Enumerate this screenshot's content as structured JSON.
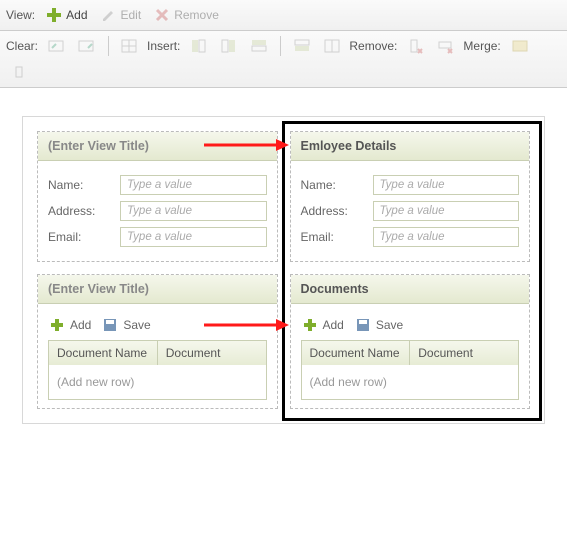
{
  "toolbar": {
    "view_label": "View:",
    "add": "Add",
    "edit": "Edit",
    "remove": "Remove",
    "clear_label": "Clear:",
    "insert_label": "Insert:",
    "remove2_label": "Remove:",
    "merge_label": "Merge:"
  },
  "views": {
    "top_left": {
      "title": "(Enter View Title)",
      "fields": [
        {
          "label": "Name:",
          "placeholder": "Type a value"
        },
        {
          "label": "Address:",
          "placeholder": "Type a value"
        },
        {
          "label": "Email:",
          "placeholder": "Type a value"
        }
      ]
    },
    "top_right": {
      "title": "Emloyee Details",
      "fields": [
        {
          "label": "Name:",
          "placeholder": "Type a value"
        },
        {
          "label": "Address:",
          "placeholder": "Type a value"
        },
        {
          "label": "Email:",
          "placeholder": "Type a value"
        }
      ]
    },
    "bottom_left": {
      "title": "(Enter View Title)",
      "toolbar": {
        "add": "Add",
        "save": "Save"
      },
      "columns": [
        "Document Name",
        "Document"
      ],
      "empty_row": "(Add new row)"
    },
    "bottom_right": {
      "title": "Documents",
      "toolbar": {
        "add": "Add",
        "save": "Save"
      },
      "columns": [
        "Document Name",
        "Document"
      ],
      "empty_row": "(Add new row)"
    }
  }
}
